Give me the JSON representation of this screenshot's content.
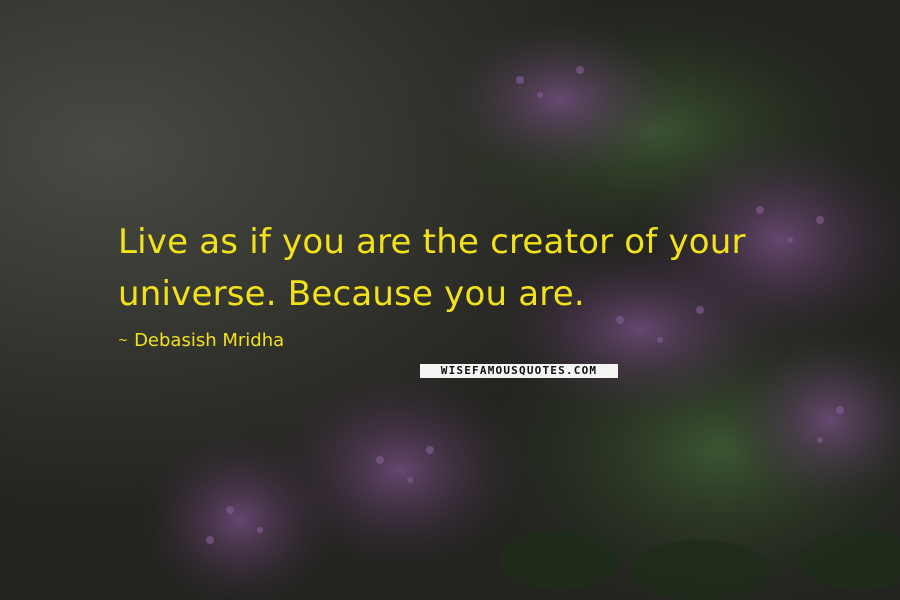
{
  "quote": {
    "line1": "Live as if you are the creator of your",
    "line2": "universe. Because you are."
  },
  "author": {
    "prefix": "~",
    "name": "Debasish Mridha"
  },
  "watermark": {
    "text": "WISEFAMOUSQUOTES.COM"
  },
  "colors": {
    "text": "#f2e21a",
    "background": "#2a2a26",
    "flowers": "#5a3a63",
    "foliage": "#2f4a2a"
  }
}
